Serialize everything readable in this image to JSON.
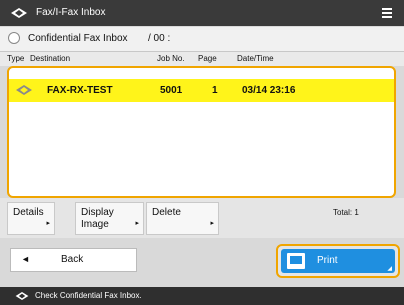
{
  "window": {
    "title": "Fax/I-Fax Inbox"
  },
  "subheader": {
    "inbox": "Confidential Fax Inbox",
    "count": "/ 00 :"
  },
  "columns": {
    "type": "Type",
    "destination": "Destination",
    "job_no": "Job No.",
    "page": "Page",
    "datetime": "Date/Time"
  },
  "rows": [
    {
      "destination": "FAX-RX-TEST",
      "job_no": "5001",
      "page": "1",
      "datetime": "03/14  23:16",
      "icon": "fax-icon"
    }
  ],
  "toolbar": {
    "details": "Details",
    "display_image_1": "Display",
    "display_image_2": "Image",
    "delete": "Delete",
    "total": "Total: 1"
  },
  "nav": {
    "back": "Back",
    "back_arrow": "◄",
    "print": "Print"
  },
  "status": {
    "message": "Check Confidential Fax Inbox."
  },
  "colors": {
    "accent": "#f0a500",
    "selected_row": "#fff41a",
    "print_button": "#1f8fe0"
  }
}
